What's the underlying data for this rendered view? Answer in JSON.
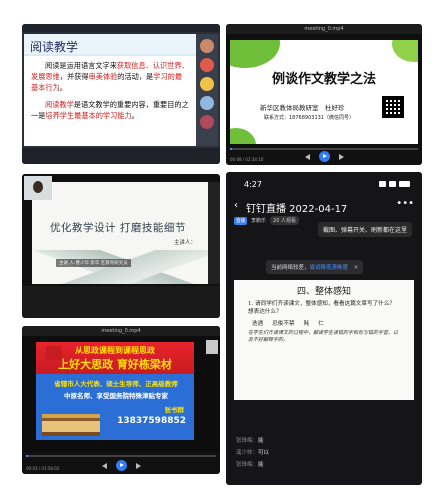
{
  "panel1": {
    "slide_title": "阅读教学",
    "para1_a": "阅读是运用语言文字来",
    "para1_red1": "获取信息、认识世界、发展思维",
    "para1_b": "，并获得",
    "para1_red2": "审美体验",
    "para1_c": "的活动，是",
    "para1_red3": "学习的最基本行为",
    "para1_d": "。",
    "para2_red": "阅读教学",
    "para2_a": "是语文教学的重要内容，重要目的之一是",
    "para2_red2": "培养学生最基本的学习能力",
    "para2_b": "。"
  },
  "panel2": {
    "window_title": "meeting_0.mp4",
    "heading": "例谈作文教学之法",
    "org": "新华区教体局教研室　杜好珍",
    "phone": "联系方式：18768903131（微信同号）",
    "time": "00:08 / 02:34:10"
  },
  "panel3": {
    "heading": "优化教学设计 打磨技能细节",
    "speaker": "主讲人：",
    "caption": "主讲 人:曹少华 新华 区教育研究员"
  },
  "panel4": {
    "time": "4:27",
    "nav_title": "钉钉直播 2022-04-17",
    "badge": "直播",
    "host": "李鹏乐",
    "viewers": "20 人观看",
    "tip": "截图、弹幕开关、刷新都在这里",
    "net_notice": "当前网络较差，",
    "net_link": "尝试降低清晰度",
    "paper_heading": "四、整体感知",
    "q1": "1. 请同学们齐读课文，整体感知，看看这篇文章写了什么？想表达什么？",
    "words": [
      "迭遇",
      "忍俊不禁",
      "耗",
      "仁"
    ],
    "handwriting": "在学生们齐读课文的过程中，解读学生读错的字和有写错的字音，以及不好解释字的。",
    "chat": [
      {
        "name": "张珠梅：",
        "text": "能"
      },
      {
        "name": "溪少帅：",
        "text": "可以"
      },
      {
        "name": "张珠梅：",
        "text": "能"
      }
    ]
  },
  "panel5": {
    "window_title": "meeting_0.mp4",
    "line1": "从思政课程到课程思政",
    "line2": "上好大思政 育好栋梁材",
    "line3": "省辖市人大代表、硕士生导师、正高级教师",
    "line4": "中原名师、享受国务院特殊津贴专家",
    "name": "张书群",
    "tel": "13837598852",
    "time": "00:03 / 01:56:02"
  }
}
